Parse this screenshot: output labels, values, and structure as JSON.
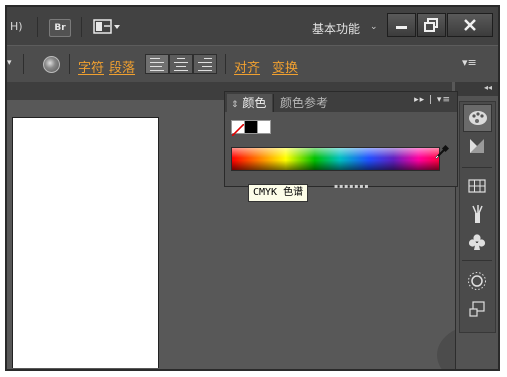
{
  "menubar": {
    "left_fragment": "H)",
    "bridge_label": "Br",
    "workspace_label": "基本功能",
    "workspace_arrow": "⌄",
    "minimize": "▬",
    "restore": "❐",
    "close": "✕"
  },
  "control_bar": {
    "dropdown_arrow": "▾",
    "char_link": "字符",
    "para_link": "段落",
    "align_link": "对齐",
    "transform_link": "变换",
    "panel_menu": "▾≡"
  },
  "dock": {
    "collapse": "◂◂"
  },
  "color_panel": {
    "active_tab": "颜色",
    "inactive_tab": "颜色参考",
    "tab_arrows": "▸▸ | ▾≡",
    "tooltip": "CMYK 色谱"
  },
  "colors": {
    "accent_link": "#f0a030",
    "panel_bg": "#535353",
    "workspace_bg": "#585858"
  }
}
